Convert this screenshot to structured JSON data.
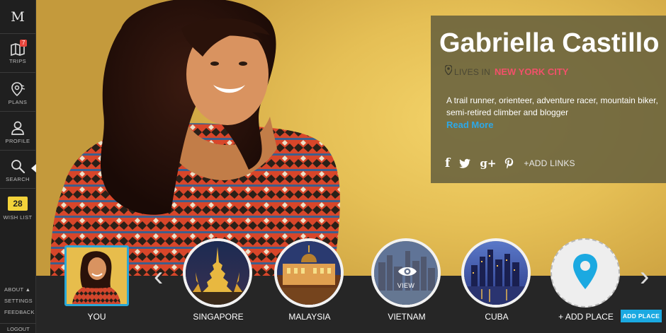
{
  "app": {
    "logo": "M"
  },
  "sidebar": {
    "items": [
      {
        "label": "TRIPS",
        "icon": "map-icon",
        "badge": "7"
      },
      {
        "label": "PLANS",
        "icon": "map-pin-icon"
      },
      {
        "label": "PROFILE",
        "icon": "person-icon"
      },
      {
        "label": "SEARCH",
        "icon": "search-icon",
        "active": true
      },
      {
        "label": "WISH LIST",
        "count": "28"
      }
    ],
    "links": [
      "ABOUT ▲",
      "SETTINGS",
      "FEEDBACK"
    ],
    "logout": "LOGOUT"
  },
  "profile": {
    "name": "Gabriella Castillo",
    "lives_in_label": "LIVES IN",
    "city": "NEW YORK CITY",
    "bio": "A trail runner, orienteer, adventure racer, mountain biker, semi-retired climber and blogger",
    "read_more": "Read More",
    "social": [
      "f",
      "twitter-icon",
      "g+",
      "pinterest-icon"
    ],
    "add_links": "+ADD LINKS"
  },
  "places": {
    "you_label": "YOU",
    "items": [
      {
        "label": "SINGAPORE"
      },
      {
        "label": "MALAYSIA"
      },
      {
        "label": "VIETNAM",
        "overlay": "VIEW"
      },
      {
        "label": "CUBA"
      }
    ],
    "add_label": "+ ADD PLACE",
    "add_button": "ADD PLACE"
  },
  "colors": {
    "accent_blue": "#1ba9e1",
    "city_pink": "#f2506a",
    "badge_red": "#e8453c",
    "wishlist_yellow": "#f2d23a"
  }
}
